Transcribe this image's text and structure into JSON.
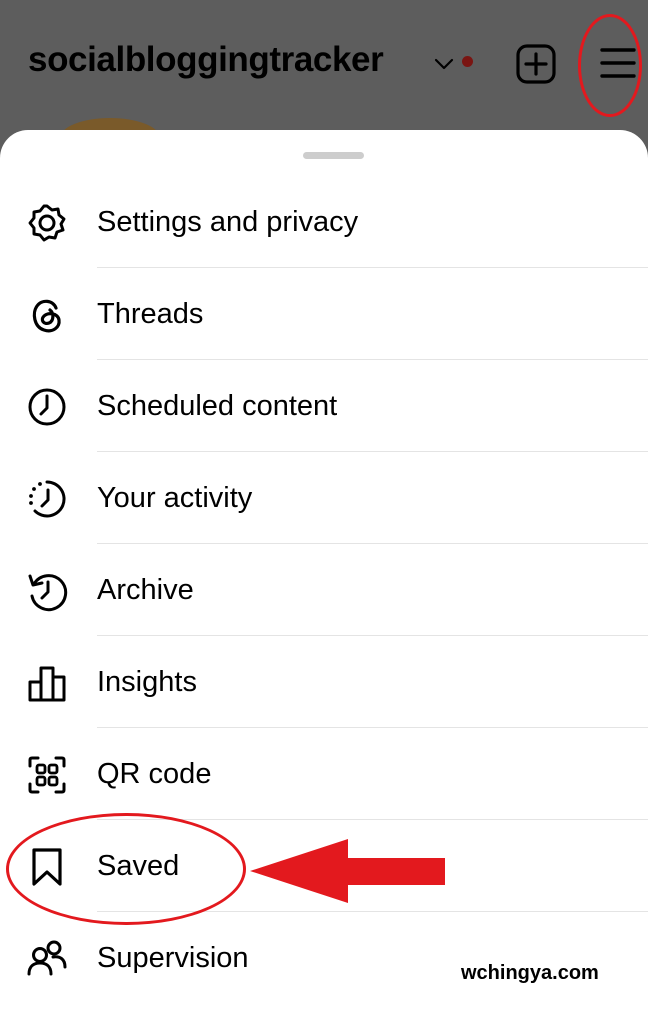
{
  "header": {
    "username": "socialbloggingtracker",
    "chevron_icon": "chevron-down-icon",
    "notification_dot_color": "#7a1512",
    "new_post_icon": "plus-square-icon",
    "menu_icon": "hamburger-menu-icon"
  },
  "menu": {
    "items": [
      {
        "label": "Settings and privacy",
        "icon": "settings-gear-icon"
      },
      {
        "label": "Threads",
        "icon": "threads-icon"
      },
      {
        "label": "Scheduled content",
        "icon": "clock-icon"
      },
      {
        "label": "Your activity",
        "icon": "activity-icon"
      },
      {
        "label": "Archive",
        "icon": "archive-history-icon"
      },
      {
        "label": "Insights",
        "icon": "bar-chart-icon"
      },
      {
        "label": "QR code",
        "icon": "qr-code-icon"
      },
      {
        "label": "Saved",
        "icon": "bookmark-icon"
      },
      {
        "label": "Supervision",
        "icon": "supervision-people-icon"
      }
    ]
  },
  "annotations": {
    "highlight_color": "#e3191e",
    "watermark": "wchingya.com"
  }
}
